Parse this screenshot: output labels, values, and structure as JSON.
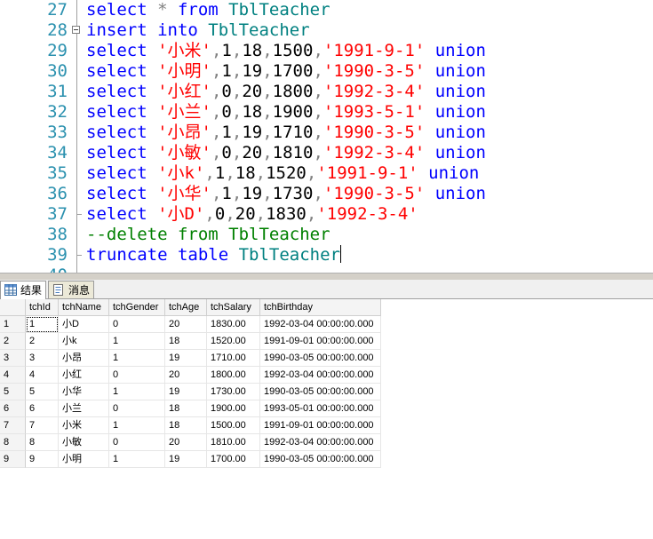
{
  "editor": {
    "lines": [
      {
        "num": "27",
        "parts": [
          [
            "kw",
            "select "
          ],
          [
            "gray",
            "* "
          ],
          [
            "kw",
            "from "
          ],
          [
            "obj",
            "TblTeacher"
          ]
        ]
      },
      {
        "num": "28",
        "parts": [
          [
            "kw",
            "insert "
          ],
          [
            "kw",
            "into "
          ],
          [
            "obj",
            "TblTeacher"
          ]
        ]
      },
      {
        "num": "29",
        "parts": [
          [
            "kw",
            "select "
          ],
          [
            "str",
            "'小米'"
          ],
          [
            "gray",
            ","
          ],
          [
            "num",
            "1"
          ],
          [
            "gray",
            ","
          ],
          [
            "num",
            "18"
          ],
          [
            "gray",
            ","
          ],
          [
            "num",
            "1500"
          ],
          [
            "gray",
            ","
          ],
          [
            "str",
            "'1991-9-1'"
          ],
          [
            "kw",
            " union"
          ]
        ]
      },
      {
        "num": "30",
        "parts": [
          [
            "kw",
            "select "
          ],
          [
            "str",
            "'小明'"
          ],
          [
            "gray",
            ","
          ],
          [
            "num",
            "1"
          ],
          [
            "gray",
            ","
          ],
          [
            "num",
            "19"
          ],
          [
            "gray",
            ","
          ],
          [
            "num",
            "1700"
          ],
          [
            "gray",
            ","
          ],
          [
            "str",
            "'1990-3-5'"
          ],
          [
            "kw",
            " union"
          ]
        ]
      },
      {
        "num": "31",
        "parts": [
          [
            "kw",
            "select "
          ],
          [
            "str",
            "'小红'"
          ],
          [
            "gray",
            ","
          ],
          [
            "num",
            "0"
          ],
          [
            "gray",
            ","
          ],
          [
            "num",
            "20"
          ],
          [
            "gray",
            ","
          ],
          [
            "num",
            "1800"
          ],
          [
            "gray",
            ","
          ],
          [
            "str",
            "'1992-3-4'"
          ],
          [
            "kw",
            " union"
          ]
        ]
      },
      {
        "num": "32",
        "parts": [
          [
            "kw",
            "select "
          ],
          [
            "str",
            "'小兰'"
          ],
          [
            "gray",
            ","
          ],
          [
            "num",
            "0"
          ],
          [
            "gray",
            ","
          ],
          [
            "num",
            "18"
          ],
          [
            "gray",
            ","
          ],
          [
            "num",
            "1900"
          ],
          [
            "gray",
            ","
          ],
          [
            "str",
            "'1993-5-1'"
          ],
          [
            "kw",
            " union"
          ]
        ]
      },
      {
        "num": "33",
        "parts": [
          [
            "kw",
            "select "
          ],
          [
            "str",
            "'小昂'"
          ],
          [
            "gray",
            ","
          ],
          [
            "num",
            "1"
          ],
          [
            "gray",
            ","
          ],
          [
            "num",
            "19"
          ],
          [
            "gray",
            ","
          ],
          [
            "num",
            "1710"
          ],
          [
            "gray",
            ","
          ],
          [
            "str",
            "'1990-3-5'"
          ],
          [
            "kw",
            " union"
          ]
        ]
      },
      {
        "num": "34",
        "parts": [
          [
            "kw",
            "select "
          ],
          [
            "str",
            "'小敏'"
          ],
          [
            "gray",
            ","
          ],
          [
            "num",
            "0"
          ],
          [
            "gray",
            ","
          ],
          [
            "num",
            "20"
          ],
          [
            "gray",
            ","
          ],
          [
            "num",
            "1810"
          ],
          [
            "gray",
            ","
          ],
          [
            "str",
            "'1992-3-4'"
          ],
          [
            "kw",
            " union"
          ]
        ]
      },
      {
        "num": "35",
        "parts": [
          [
            "kw",
            "select "
          ],
          [
            "str",
            "'小k'"
          ],
          [
            "gray",
            ","
          ],
          [
            "num",
            "1"
          ],
          [
            "gray",
            ","
          ],
          [
            "num",
            "18"
          ],
          [
            "gray",
            ","
          ],
          [
            "num",
            "1520"
          ],
          [
            "gray",
            ","
          ],
          [
            "str",
            "'1991-9-1'"
          ],
          [
            "kw",
            " union"
          ]
        ]
      },
      {
        "num": "36",
        "parts": [
          [
            "kw",
            "select "
          ],
          [
            "str",
            "'小华'"
          ],
          [
            "gray",
            ","
          ],
          [
            "num",
            "1"
          ],
          [
            "gray",
            ","
          ],
          [
            "num",
            "19"
          ],
          [
            "gray",
            ","
          ],
          [
            "num",
            "1730"
          ],
          [
            "gray",
            ","
          ],
          [
            "str",
            "'1990-3-5'"
          ],
          [
            "kw",
            " union"
          ]
        ]
      },
      {
        "num": "37",
        "parts": [
          [
            "kw",
            "select "
          ],
          [
            "str",
            "'小D'"
          ],
          [
            "gray",
            ","
          ],
          [
            "num",
            "0"
          ],
          [
            "gray",
            ","
          ],
          [
            "num",
            "20"
          ],
          [
            "gray",
            ","
          ],
          [
            "num",
            "1830"
          ],
          [
            "gray",
            ","
          ],
          [
            "str",
            "'1992-3-4'"
          ]
        ]
      },
      {
        "num": "38",
        "parts": [
          [
            "cm",
            "--delete from TblTeacher"
          ]
        ]
      },
      {
        "num": "39",
        "parts": [
          [
            "kw",
            "truncate "
          ],
          [
            "kw",
            "table "
          ],
          [
            "obj",
            "TblTeacher"
          ]
        ]
      },
      {
        "num": "40",
        "parts": []
      }
    ]
  },
  "tabs": {
    "results": "结果",
    "messages": "消息"
  },
  "grid": {
    "columns": [
      "tchId",
      "tchName",
      "tchGender",
      "tchAge",
      "tchSalary",
      "tchBirthday"
    ],
    "rows": [
      {
        "n": "1",
        "cells": [
          "1",
          "小D",
          "0",
          "20",
          "1830.00",
          "1992-03-04 00:00:00.000"
        ]
      },
      {
        "n": "2",
        "cells": [
          "2",
          "小k",
          "1",
          "18",
          "1520.00",
          "1991-09-01 00:00:00.000"
        ]
      },
      {
        "n": "3",
        "cells": [
          "3",
          "小昂",
          "1",
          "19",
          "1710.00",
          "1990-03-05 00:00:00.000"
        ]
      },
      {
        "n": "4",
        "cells": [
          "4",
          "小红",
          "0",
          "20",
          "1800.00",
          "1992-03-04 00:00:00.000"
        ]
      },
      {
        "n": "5",
        "cells": [
          "5",
          "小华",
          "1",
          "19",
          "1730.00",
          "1990-03-05 00:00:00.000"
        ]
      },
      {
        "n": "6",
        "cells": [
          "6",
          "小兰",
          "0",
          "18",
          "1900.00",
          "1993-05-01 00:00:00.000"
        ]
      },
      {
        "n": "7",
        "cells": [
          "7",
          "小米",
          "1",
          "18",
          "1500.00",
          "1991-09-01 00:00:00.000"
        ]
      },
      {
        "n": "8",
        "cells": [
          "8",
          "小敏",
          "0",
          "20",
          "1810.00",
          "1992-03-04 00:00:00.000"
        ]
      },
      {
        "n": "9",
        "cells": [
          "9",
          "小明",
          "1",
          "19",
          "1700.00",
          "1990-03-05 00:00:00.000"
        ]
      }
    ]
  },
  "colors": {
    "keyword": "#0000ff",
    "string": "#ff0000",
    "comment": "#008000",
    "object": "#008080",
    "line_number": "#2b91af"
  },
  "icons": {
    "results_tab": "grid-icon",
    "messages_tab": "message-icon",
    "fold": "collapse-icon"
  }
}
